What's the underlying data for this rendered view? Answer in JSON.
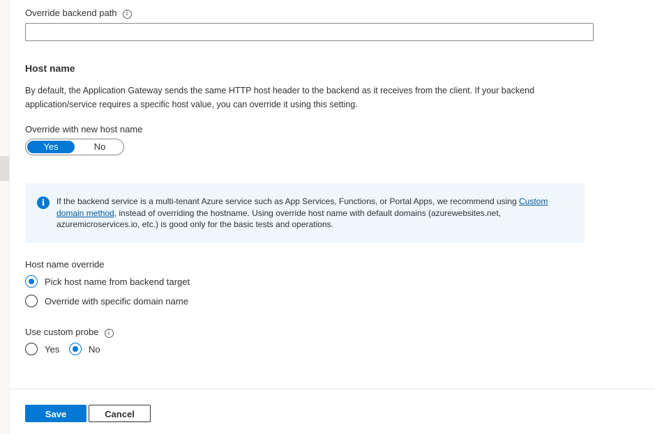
{
  "backend_path": {
    "label": "Override backend path",
    "value": "",
    "info_icon": "info-icon"
  },
  "host_name": {
    "title": "Host name",
    "description": "By default, the Application Gateway sends the same HTTP host header to the backend as it receives from the client. If your backend application/service requires a specific host value, you can override it using this setting."
  },
  "override_host": {
    "label": "Override with new host name",
    "yes": "Yes",
    "no": "No",
    "selected": "Yes"
  },
  "info_banner": {
    "icon": "info-icon",
    "text_before": "If the backend service is a multi-tenant Azure service such as App Services, Functions, or Portal Apps, we recommend using ",
    "link": "Custom domain method",
    "text_after": ", instead of overriding the hostname. Using override host name with default domains (azurewebsites.net, azuremicroservices.io, etc.) is good only for the basic tests and operations."
  },
  "host_name_override": {
    "label": "Host name override",
    "options": [
      "Pick host name from backend target",
      "Override with specific domain name"
    ],
    "selected": "Pick host name from backend target"
  },
  "custom_probe": {
    "label": "Use custom probe",
    "info_icon": "info-icon",
    "options": [
      "Yes",
      "No"
    ],
    "selected": "No"
  },
  "footer": {
    "save_label": "Save",
    "cancel_label": "Cancel"
  },
  "colors": {
    "accent": "#0078d4",
    "info_background": "#eff6fc"
  }
}
